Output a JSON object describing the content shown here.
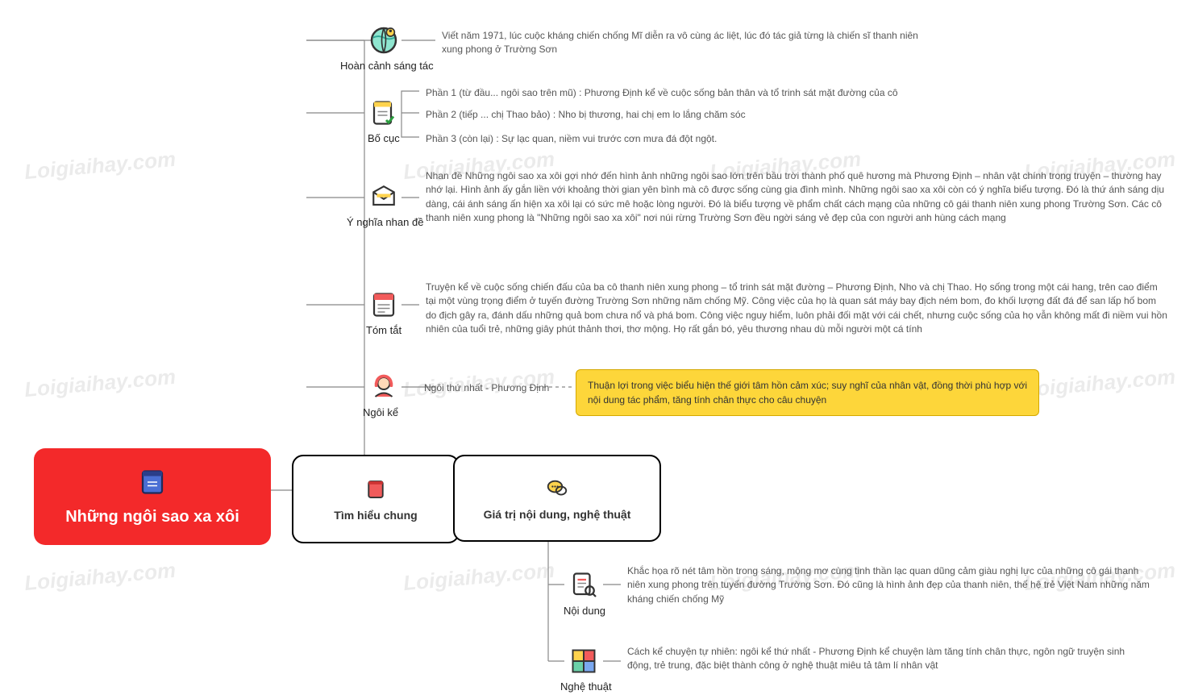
{
  "root": {
    "title": "Những ngôi sao xa xôi"
  },
  "level1": {
    "a": {
      "label": "Tìm hiểu chung"
    },
    "b": {
      "label": "Giá trị nội dung, nghệ thuật"
    }
  },
  "sections": {
    "hoancanh": {
      "label": "Hoàn cảnh sáng tác",
      "text": "Viết năm 1971, lúc cuộc kháng chiến chống Mĩ diễn ra vô cùng ác liệt, lúc đó tác giả từng là chiến sĩ thanh niên xung phong ở Trường Sơn"
    },
    "bocuc": {
      "label": "Bố cục",
      "p1": "Phần 1 (từ đầu... ngôi sao trên mũ) : Phương Định kể về cuộc sống bản thân và tổ trinh sát mặt đường của cô",
      "p2": "Phần 2 (tiếp ... chị Thao bảo) : Nho bị thương, hai chị em lo lắng chăm sóc",
      "p3": "Phần 3 (còn lại) : Sự lạc quan, niềm vui trước cơn mưa đá đột ngột."
    },
    "ynghia": {
      "label": "Ý nghĩa nhan đề",
      "text": "Nhan đề Những ngôi sao xa xôi gợi nhớ đến hình ảnh những ngôi sao lớn trên bầu trời thành phố quê hương mà Phương Định – nhân vật chính trong truyện – thường hay nhớ lại. Hình ảnh ấy gắn liền với khoảng thời gian yên bình mà cô được sống cùng gia đình mình. Những ngôi sao xa xôi còn có ý nghĩa biểu tượng. Đó là thứ ánh sáng dịu dàng, cái ánh sáng ấn hiện xa xôi lại có sức mê hoặc lòng người. Đó là biểu tượng về phẩm chất cách mạng của những cô gái thanh niên xung phong Trường Sơn. Các cô thanh niên xung phong là \"Những ngôi sao xa xôi\" nơi núi rừng Trường Sơn đều ngời sáng vẻ đẹp của con người anh hùng cách mạng"
    },
    "tomtat": {
      "label": "Tóm tắt",
      "text": "Truyện kể về cuộc sống chiến đấu của ba cô thanh niên xung phong – tổ trinh sát mặt đường – Phương Định, Nho và chị Thao. Họ sống trong một cái hang, trên cao điểm tại một vùng trọng điểm ở tuyến đường Trường Sơn những năm chống Mỹ. Công việc của họ là quan sát máy bay địch ném bom, đo khối lượng đất đá để san lấp hố bom do địch gây ra, đánh dấu những quả bom chưa nổ và phá bom. Công việc nguy hiểm, luôn phải đối mặt với cái chết, nhưng cuộc sống của họ vẫn không mất đi niềm vui hồn nhiên của tuổi trẻ, những giây phút thảnh thơi, thơ mộng. Họ rất gắn bó, yêu thương nhau dù mỗi người một cá tính"
    },
    "ngoike": {
      "label": "Ngôi kể",
      "mid": "Ngôi thứ nhất - Phương Định",
      "highlight": "Thuận lợi trong việc biểu hiện thế giới tâm hồn cảm xúc; suy nghĩ của nhân vật, đồng thời phù hợp với nội dung tác phẩm, tăng tính chân thực cho câu chuyện"
    },
    "noidung": {
      "label": "Nội dung",
      "text": "Khắc họa rõ nét tâm hồn trong sáng, mộng mơ cùng tinh thần lạc quan dũng cảm giàu nghị lực của những cô gái thanh niên xung phong trên tuyến đường Trường Sơn. Đó cũng là hình ảnh đẹp của thanh niên, thế hệ trẻ Việt Nam những năm kháng chiến chống Mỹ"
    },
    "nghethuat": {
      "label": "Nghệ thuật",
      "text": "Cách kể chuyện tự nhiên: ngôi kể thứ nhất - Phương Định kể chuyện làm tăng tính chân thực, ngôn ngữ truyện sinh động, trẻ trung, đặc biệt thành công ở nghệ thuật miêu tả tâm lí nhân vật"
    }
  },
  "watermark": "Loigiaihay.com"
}
